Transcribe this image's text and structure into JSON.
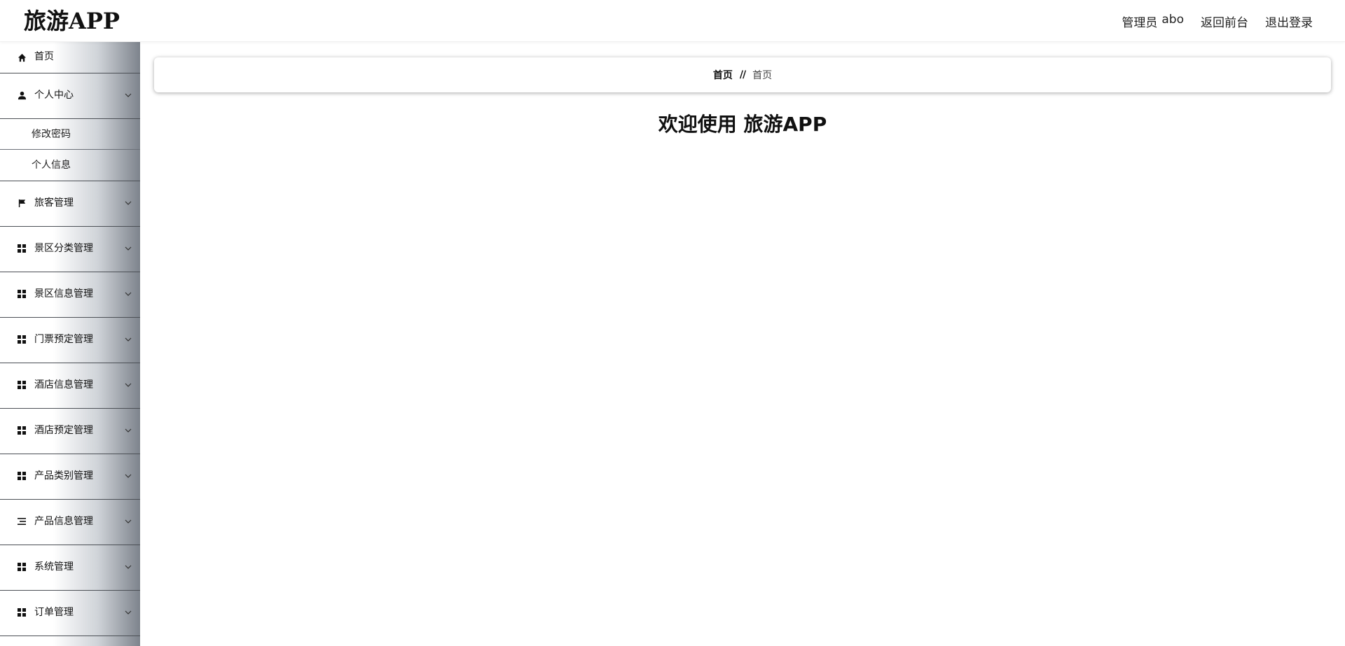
{
  "app": {
    "title": "旅游APP"
  },
  "header": {
    "admin_role": "管理员",
    "admin_name": "abo",
    "back_to_front": "返回前台",
    "logout": "退出登录"
  },
  "sidebar": {
    "home": {
      "label": "首页",
      "icon": "home-icon"
    },
    "personal": {
      "label": "个人中心",
      "icon": "user-icon",
      "children": [
        "修改密码",
        "个人信息"
      ]
    },
    "items": [
      {
        "label": "旅客管理",
        "icon": "flag-icon"
      },
      {
        "label": "景区分类管理",
        "icon": "grid-icon"
      },
      {
        "label": "景区信息管理",
        "icon": "grid-icon"
      },
      {
        "label": "门票预定管理",
        "icon": "grid-icon"
      },
      {
        "label": "酒店信息管理",
        "icon": "grid-icon"
      },
      {
        "label": "酒店预定管理",
        "icon": "grid-icon"
      },
      {
        "label": "产品类别管理",
        "icon": "grid-icon"
      },
      {
        "label": "产品信息管理",
        "icon": "list-icon"
      },
      {
        "label": "系统管理",
        "icon": "grid-icon"
      },
      {
        "label": "订单管理",
        "icon": "grid-icon"
      }
    ]
  },
  "breadcrumb": {
    "first": "首页",
    "separator": "//",
    "current": "首页"
  },
  "main": {
    "welcome": "欢迎使用 旅游APP"
  },
  "colors": {
    "sidebar_gradient_end": "#7d838c",
    "divider": "#4b4f55"
  }
}
